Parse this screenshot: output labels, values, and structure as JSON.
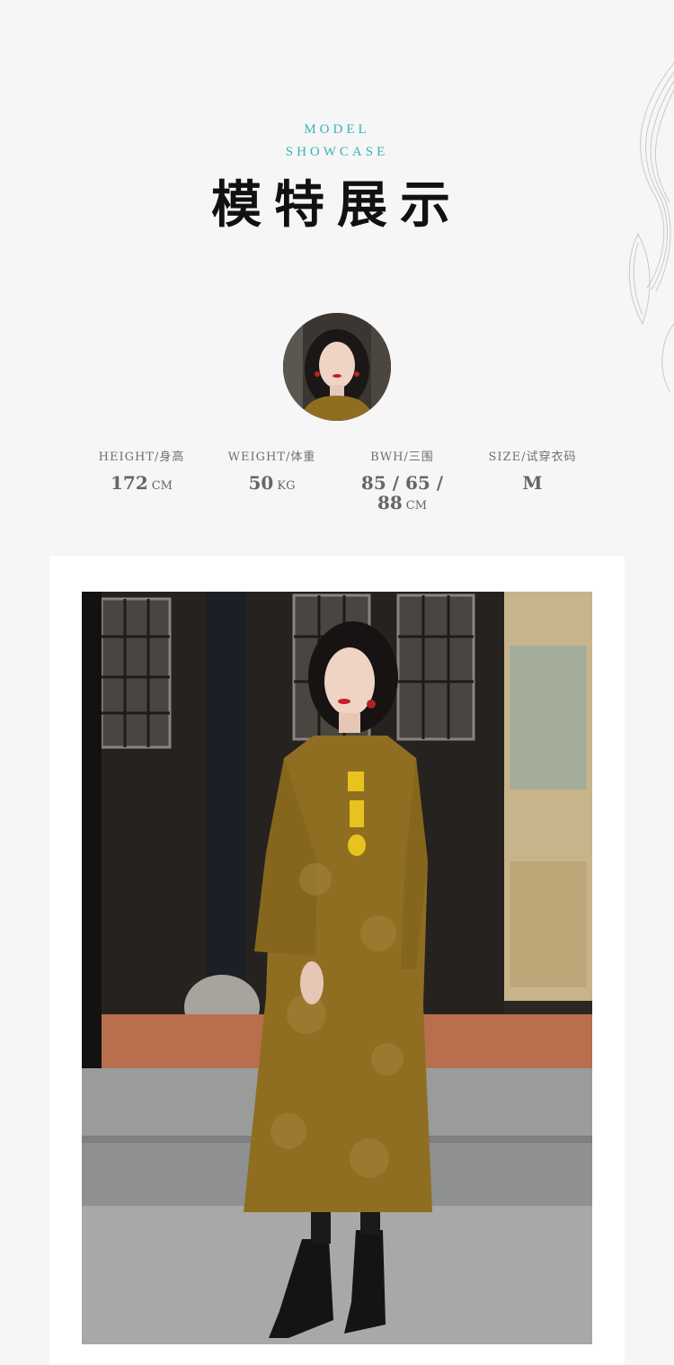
{
  "header": {
    "subtitle_line1": "MODEL",
    "subtitle_line2": "SHOWCASE",
    "title": "模特展示"
  },
  "stats": [
    {
      "label": "HEIGHT/身高",
      "value": "172",
      "unit": "CM"
    },
    {
      "label": "WEIGHT/体重",
      "value": "50",
      "unit": "KG"
    },
    {
      "label": "BWH/三围",
      "value": "85 / 65 / 88",
      "unit": "CM"
    },
    {
      "label": "SIZE/试穿衣码",
      "value": "M",
      "unit": ""
    }
  ],
  "colors": {
    "accent": "#38b3b5",
    "title": "#111111",
    "dress": "#8f6e22",
    "background": "#f6f6f6"
  }
}
